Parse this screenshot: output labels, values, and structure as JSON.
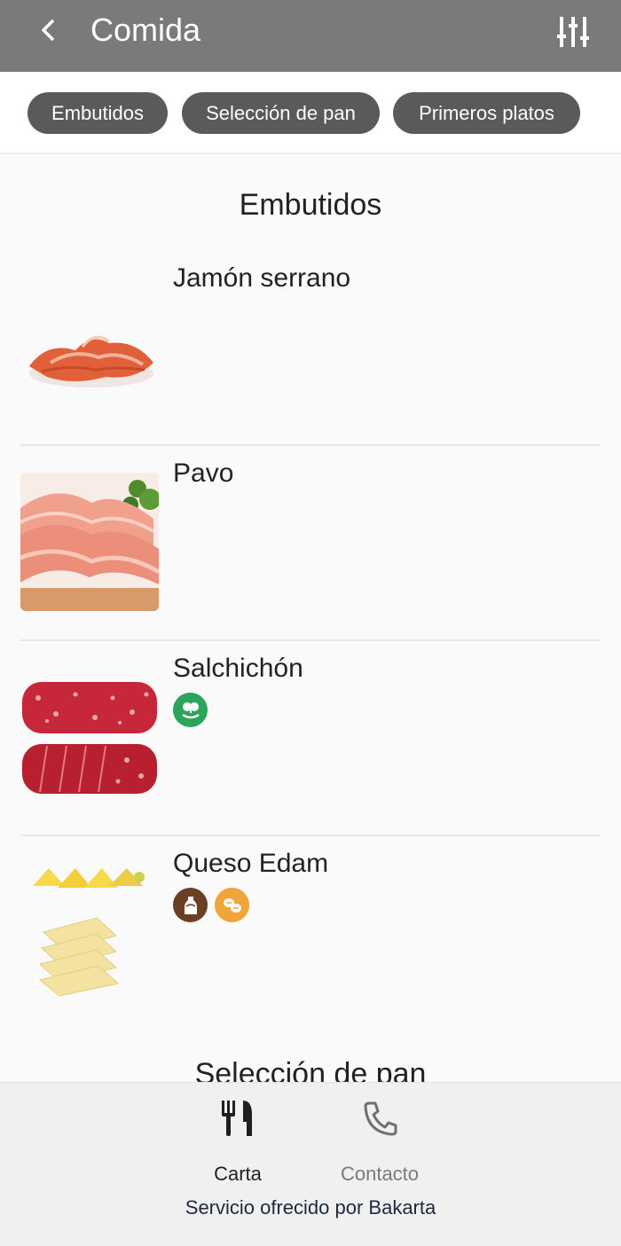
{
  "appbar": {
    "title": "Comida",
    "back_icon": "chevron-left-icon",
    "filter_icon": "sliders-icon",
    "background": "#7a7a7a"
  },
  "categories": [
    {
      "label": "Embutidos"
    },
    {
      "label": "Selección de pan"
    },
    {
      "label": "Primeros platos"
    }
  ],
  "sections": [
    {
      "title": "Embutidos",
      "items": [
        {
          "name": "Jamón serrano",
          "allergens": []
        },
        {
          "name": "Pavo",
          "allergens": []
        },
        {
          "name": "Salchichón",
          "allergens": [
            "soy"
          ]
        },
        {
          "name": "Queso Edam",
          "allergens": [
            "milk",
            "nuts"
          ]
        }
      ]
    },
    {
      "title": "Selección de pan",
      "items": []
    }
  ],
  "bottom_nav": {
    "carta": {
      "label": "Carta",
      "icon": "utensils-icon"
    },
    "contacto": {
      "label": "Contacto",
      "icon": "phone-icon"
    }
  },
  "footer_text": "Servicio ofrecido por Bakarta",
  "colors": {
    "chip": "#5a5a5a",
    "allergen_soy": "#2aa55a",
    "allergen_milk": "#6b3f23",
    "allergen_nuts": "#f0a43a"
  }
}
